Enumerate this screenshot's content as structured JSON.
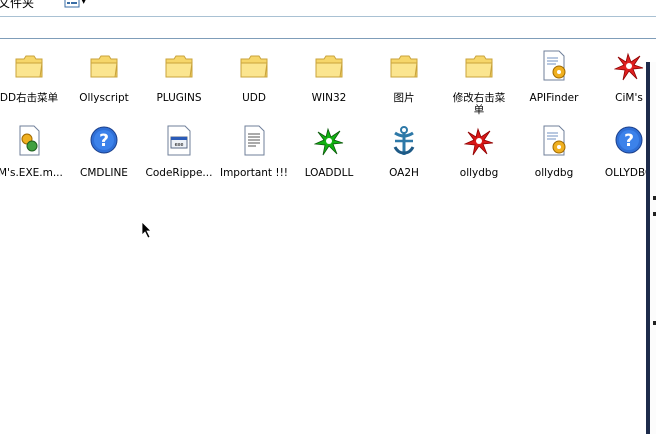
{
  "toolbar": {
    "label": "文件夹",
    "view_icon": "views-icon"
  },
  "items_row1": [
    {
      "label": "DD右击菜单",
      "icon": "folder-icon"
    },
    {
      "label": "Ollyscript",
      "icon": "folder-icon"
    },
    {
      "label": "PLUGINS",
      "icon": "folder-icon"
    },
    {
      "label": "UDD",
      "icon": "folder-icon"
    },
    {
      "label": "WIN32",
      "icon": "folder-icon"
    },
    {
      "label": "图片",
      "icon": "folder-icon"
    },
    {
      "label": "修改右击菜\n单",
      "icon": "folder-icon"
    },
    {
      "label": "APIFinder",
      "icon": "config-file-icon"
    },
    {
      "label": "CiM's",
      "icon": "red-splat-icon"
    }
  ],
  "items_row2": [
    {
      "label": "iM's.EXE.m...",
      "icon": "manifest-file-icon"
    },
    {
      "label": "CMDLINE",
      "icon": "help-icon"
    },
    {
      "label": "CodeRippe...",
      "icon": "app-window-icon"
    },
    {
      "label": "Important !!!",
      "icon": "text-document-icon"
    },
    {
      "label": "LOADDLL",
      "icon": "green-splat-icon"
    },
    {
      "label": "OA2H",
      "icon": "oa2h-icon"
    },
    {
      "label": "ollydbg",
      "icon": "red-splat-icon"
    },
    {
      "label": "ollydbg",
      "icon": "config-file-icon"
    },
    {
      "label": "OLLYDBG",
      "icon": "help-icon"
    }
  ]
}
